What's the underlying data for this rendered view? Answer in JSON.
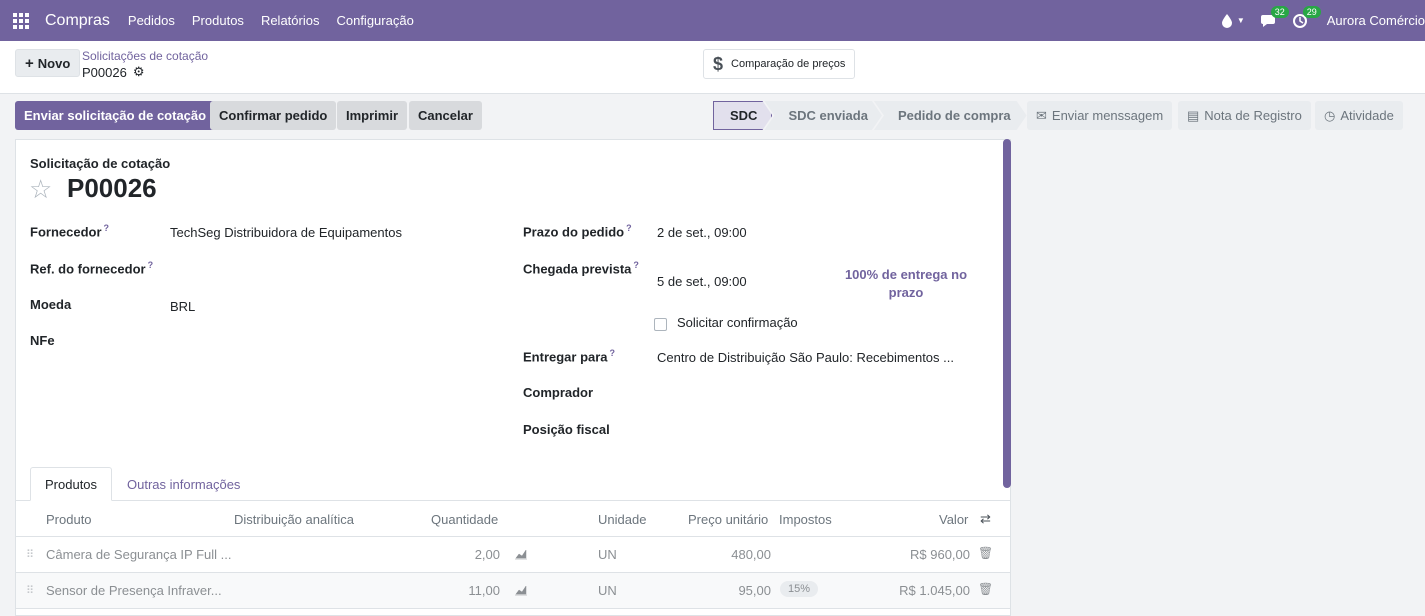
{
  "navbar": {
    "app_name": "Compras",
    "menu": [
      "Pedidos",
      "Produtos",
      "Relatórios",
      "Configuração"
    ],
    "messages_count": "32",
    "activities_count": "29",
    "user": "Aurora Comércio"
  },
  "control": {
    "new_label": "Novo",
    "breadcrumb": "Solicitações de cotação",
    "record_name": "P00026",
    "smart_button": "Comparação de preços"
  },
  "actions": {
    "send_rfq": "Enviar solicitação de cotação",
    "confirm": "Confirmar pedido",
    "print": "Imprimir",
    "cancel": "Cancelar"
  },
  "statusbar": {
    "stages": [
      "SDC",
      "SDC enviada",
      "Pedido de compra"
    ],
    "active": "SDC"
  },
  "chatter": {
    "send_message": "Enviar menssagem",
    "log_note": "Nota de Registro",
    "activity": "Atividade"
  },
  "form": {
    "subtitle": "Solicitação de cotação",
    "title": "P00026",
    "left": {
      "vendor_label": "Fornecedor",
      "vendor_value": "TechSeg Distribuidora de Equipamentos",
      "vendor_ref_label": "Ref. do fornecedor",
      "currency_label": "Moeda",
      "currency_value": "BRL",
      "nfe_label": "NFe"
    },
    "right": {
      "deadline_label": "Prazo do pedido",
      "deadline_value": "2 de set., 09:00",
      "arrival_label": "Chegada prevista",
      "arrival_value": "5 de set., 09:00",
      "on_time": "100% de entrega no prazo",
      "ask_confirm": "Solicitar confirmação",
      "deliver_to_label": "Entregar para",
      "deliver_to_value": "Centro de Distribuição São Paulo: Recebimentos ...",
      "buyer_label": "Comprador",
      "fiscal_label": "Posição fiscal"
    }
  },
  "tabs": [
    "Produtos",
    "Outras informações"
  ],
  "table": {
    "headers": [
      "Produto",
      "Distribuição analítica",
      "Quantidade",
      "Unidade",
      "Preço unitário",
      "Impostos",
      "Valor"
    ],
    "rows": [
      {
        "product": "Câmera de Segurança IP Full ...",
        "qty": "2,00",
        "unit": "UN",
        "price": "480,00",
        "tax": "",
        "total": "R$ 960,00"
      },
      {
        "product": "Sensor de Presença Infraver...",
        "qty": "11,00",
        "unit": "UN",
        "price": "95,00",
        "tax": "15%",
        "total": "R$ 1.045,00"
      }
    ]
  },
  "colors": {
    "brand": "#71639e",
    "badge": "#28a745"
  }
}
